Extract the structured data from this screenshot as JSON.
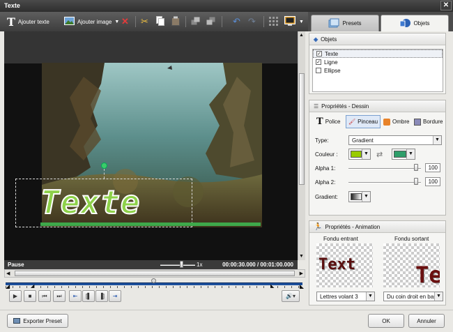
{
  "window": {
    "title": "Texte",
    "close_glyph": "✕"
  },
  "toolbar": {
    "add_text_label": "Ajouter texte",
    "add_image_label": "Ajouter image"
  },
  "tabs": {
    "presets": "Presets",
    "objects": "Objets"
  },
  "preview": {
    "overlay_text": "Texte"
  },
  "status": {
    "state": "Pause",
    "speed": "1x",
    "time": "00:00:30.000 / 00:01:00.000"
  },
  "objects_panel": {
    "title": "Objets",
    "items": [
      {
        "label": "Texte",
        "checked": true
      },
      {
        "label": "Ligne",
        "checked": true
      },
      {
        "label": "Ellipse",
        "checked": false
      }
    ]
  },
  "drawing_panel": {
    "title": "Propriétés - Dessin",
    "tabs": {
      "font": "Police",
      "brush": "Pinceau",
      "shadow": "Ombre",
      "border": "Bordure"
    },
    "type_label": "Type:",
    "type_value": "Gradient",
    "color_label": "Couleur :",
    "color1": "#99cc00",
    "color2": "#2e9e6a",
    "alpha1_label": "Alpha 1:",
    "alpha1_value": "100",
    "alpha2_label": "Alpha 2:",
    "alpha2_value": "100",
    "gradient_label": "Gradient:"
  },
  "animation_panel": {
    "title": "Propriétés - Animation",
    "fade_in_label": "Fondu entrant",
    "fade_out_label": "Fondu sortant",
    "fade_in_preview_text": "Text",
    "fade_out_preview_text": "Te",
    "fade_in_value": "Lettres volant 3",
    "fade_out_value": "Du coin droit en bas"
  },
  "footer": {
    "export_label": "Exporter Preset",
    "ok_label": "OK",
    "cancel_label": "Annuler"
  },
  "colors": {
    "accent": "#1c4f9c",
    "text_fill": "#8ed14a",
    "text_stroke": "#ffffff"
  }
}
